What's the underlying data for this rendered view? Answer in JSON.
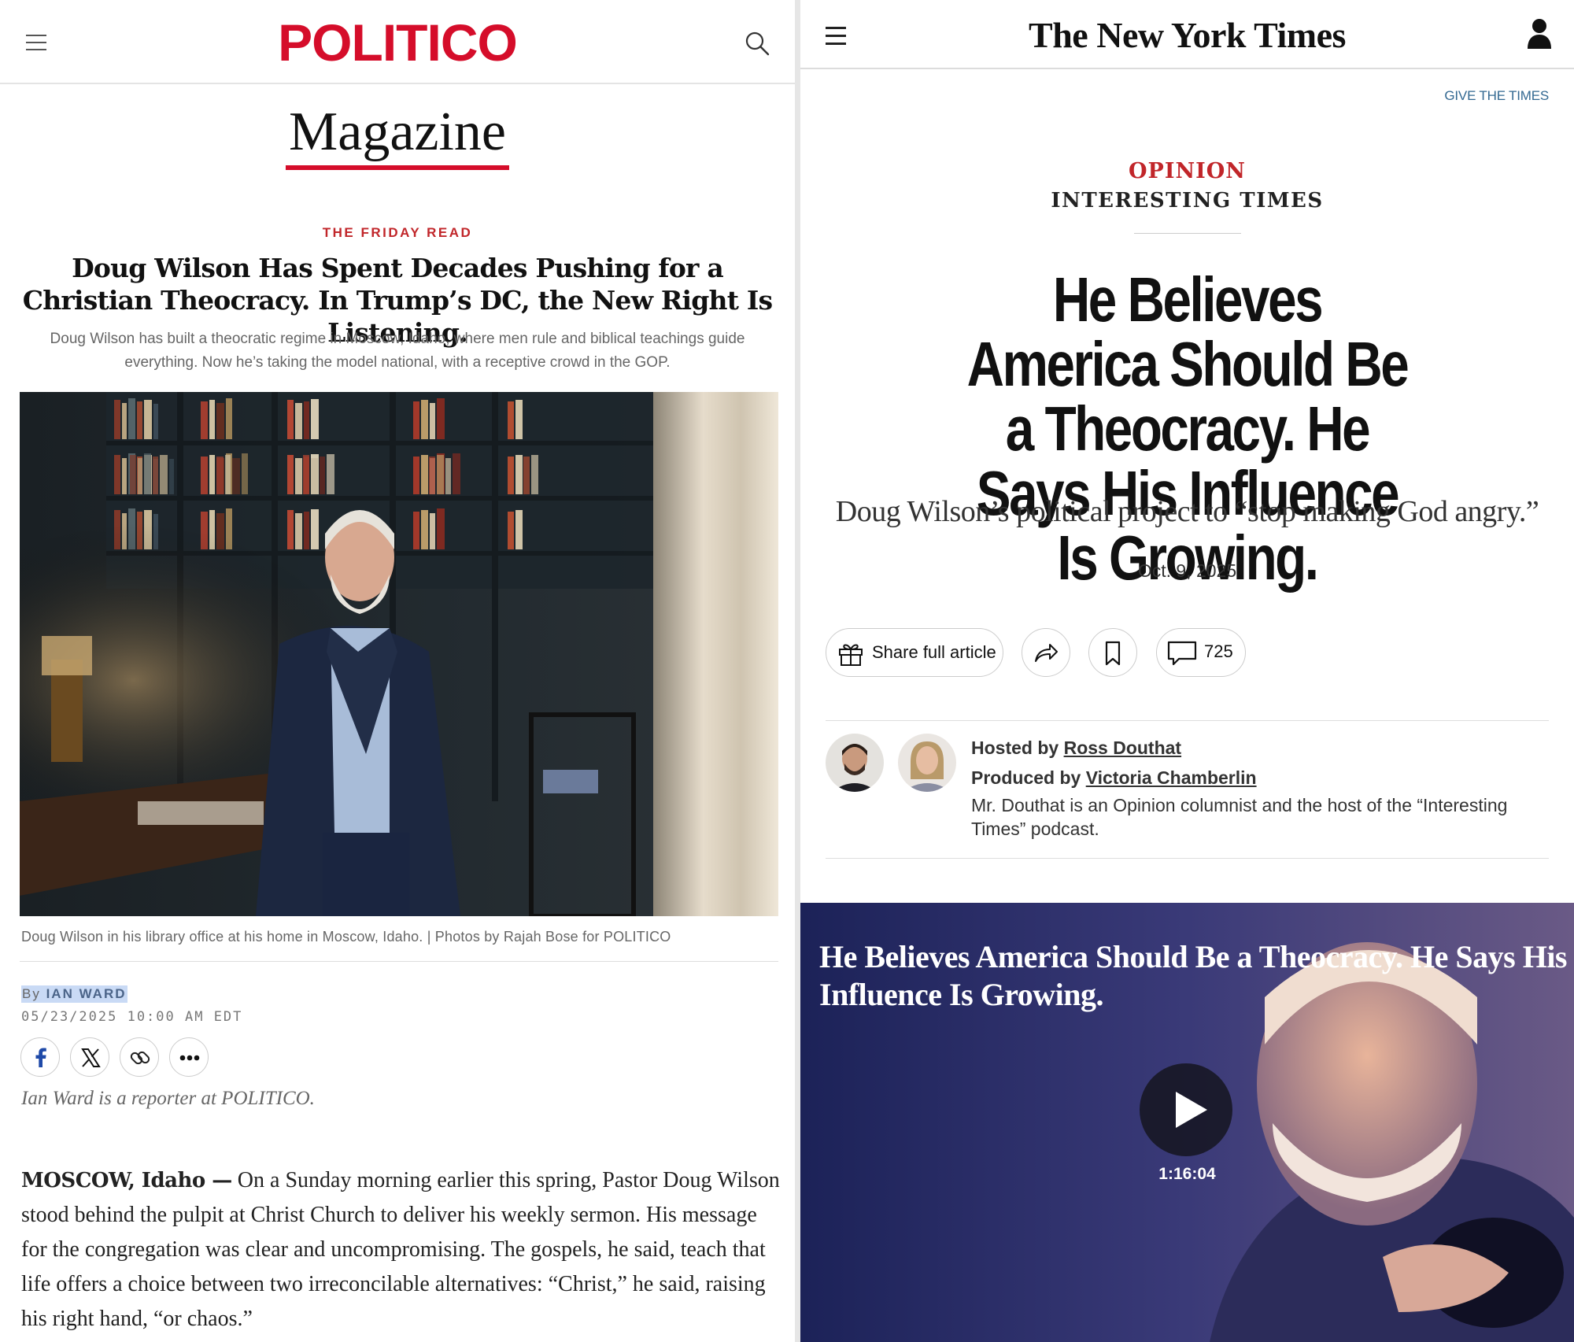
{
  "politico": {
    "logo": "POLITICO",
    "section": "Magazine",
    "kicker": "THE FRIDAY READ",
    "headline": "Doug Wilson Has Spent Decades Pushing for a Christian Theocracy. In Trump’s DC, the New Right Is Listening.",
    "dek": "Doug Wilson has built a theocratic regime in Moscow, Idaho, where men rule and biblical teachings guide everything. Now he’s taking the model national, with a receptive crowd in the GOP.",
    "photo_caption": "Doug Wilson in his library office at his home in Moscow, Idaho. | Photos by Rajah Bose for POLITICO",
    "byline_prefix": "By",
    "author": "IAN WARD",
    "timestamp": "05/23/2025 10:00 AM EDT",
    "share_icons": [
      "facebook-icon",
      "x-icon",
      "link-icon",
      "more-icon"
    ],
    "author_bio": "Ian Ward is a reporter at POLITICO.",
    "dateline": "MOSCOW, Idaho —",
    "body": "On a Sunday morning earlier this spring, Pastor Doug Wilson stood behind the pulpit at Christ Church to deliver his weekly sermon. His message for the congregation was clear and uncompromising. The gospels, he said, teach that life offers a choice between two irreconcilable alternatives: “Christ,” he said, raising his right hand, “or chaos.”",
    "brand_color": "#d50d2a"
  },
  "nyt": {
    "logo": "The New York Times",
    "give_link": "GIVE THE TIMES",
    "section": "OPINION",
    "series": "INTERESTING TIMES",
    "headline": "He Believes America Should Be a Theocracy. He Says His Influence Is Growing.",
    "dek": "Doug Wilson’s political project to “stop making God angry.”",
    "date": "Oct. 9, 2025",
    "share_label": "Share full article",
    "comment_count": "725",
    "hosted_prefix": "Hosted by",
    "host": "Ross Douthat",
    "produced_prefix": "Produced by",
    "producer": "Victoria Chamberlin",
    "bio": "Mr. Douthat is an Opinion columnist and the host of the “Interesting Times” podcast.",
    "video_title": "He Believes America Should Be a Theocracy. He Says His Influence Is Growing.",
    "video_duration": "1:16:04",
    "opinion_color": "#c1262a",
    "link_color": "#326891"
  }
}
